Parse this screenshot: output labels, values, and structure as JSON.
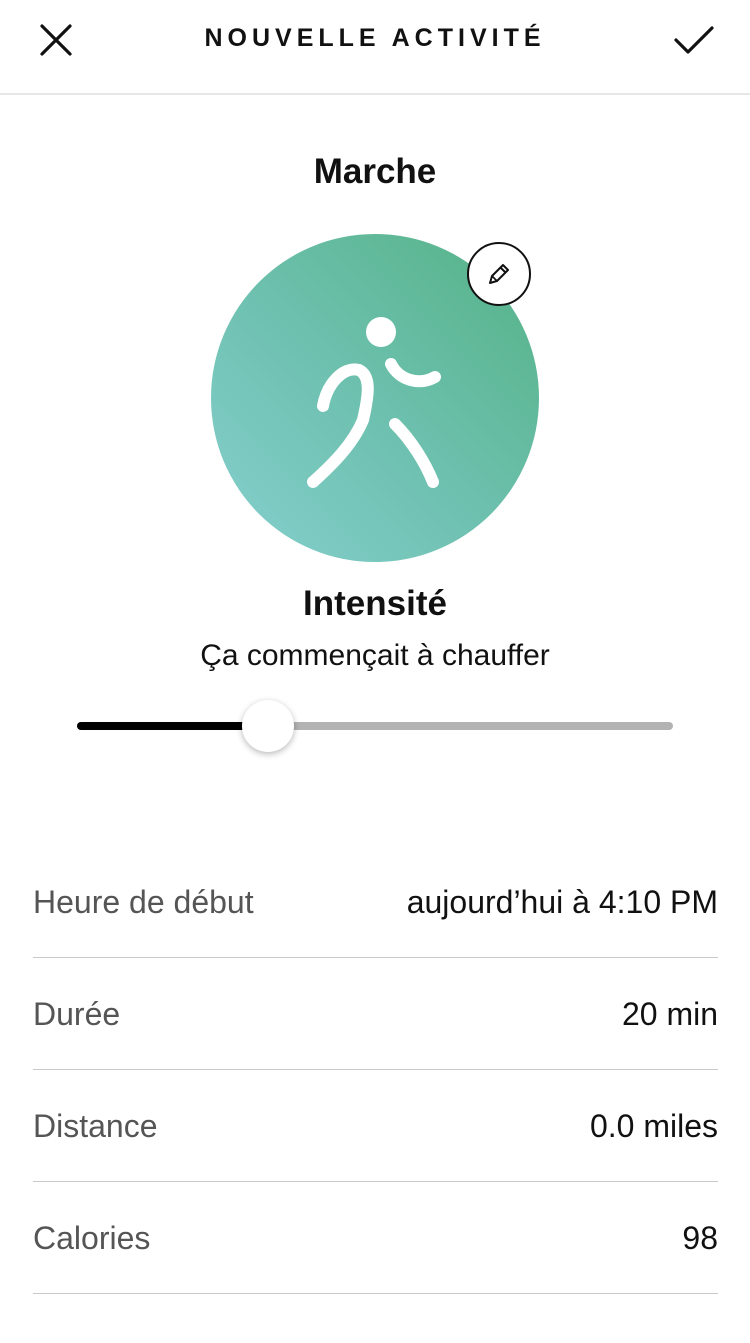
{
  "header": {
    "title": "NOUVELLE ACTIVITÉ",
    "close_icon": "close-icon",
    "confirm_icon": "checkmark-icon"
  },
  "activity": {
    "name": "Marche",
    "icon": "walking-person-icon",
    "edit_icon": "pencil-icon",
    "gradient_colors": [
      "#86d0cf",
      "#54b285"
    ]
  },
  "intensity": {
    "label": "Intensité",
    "value_text": "Ça commençait à chauffer",
    "level": 0.32
  },
  "details": [
    {
      "label": "Heure de début",
      "value": "aujourd’hui à 4:10 PM"
    },
    {
      "label": "Durée",
      "value": "20 min"
    },
    {
      "label": "Distance",
      "value": "0.0 miles"
    },
    {
      "label": "Calories",
      "value": "98"
    }
  ]
}
